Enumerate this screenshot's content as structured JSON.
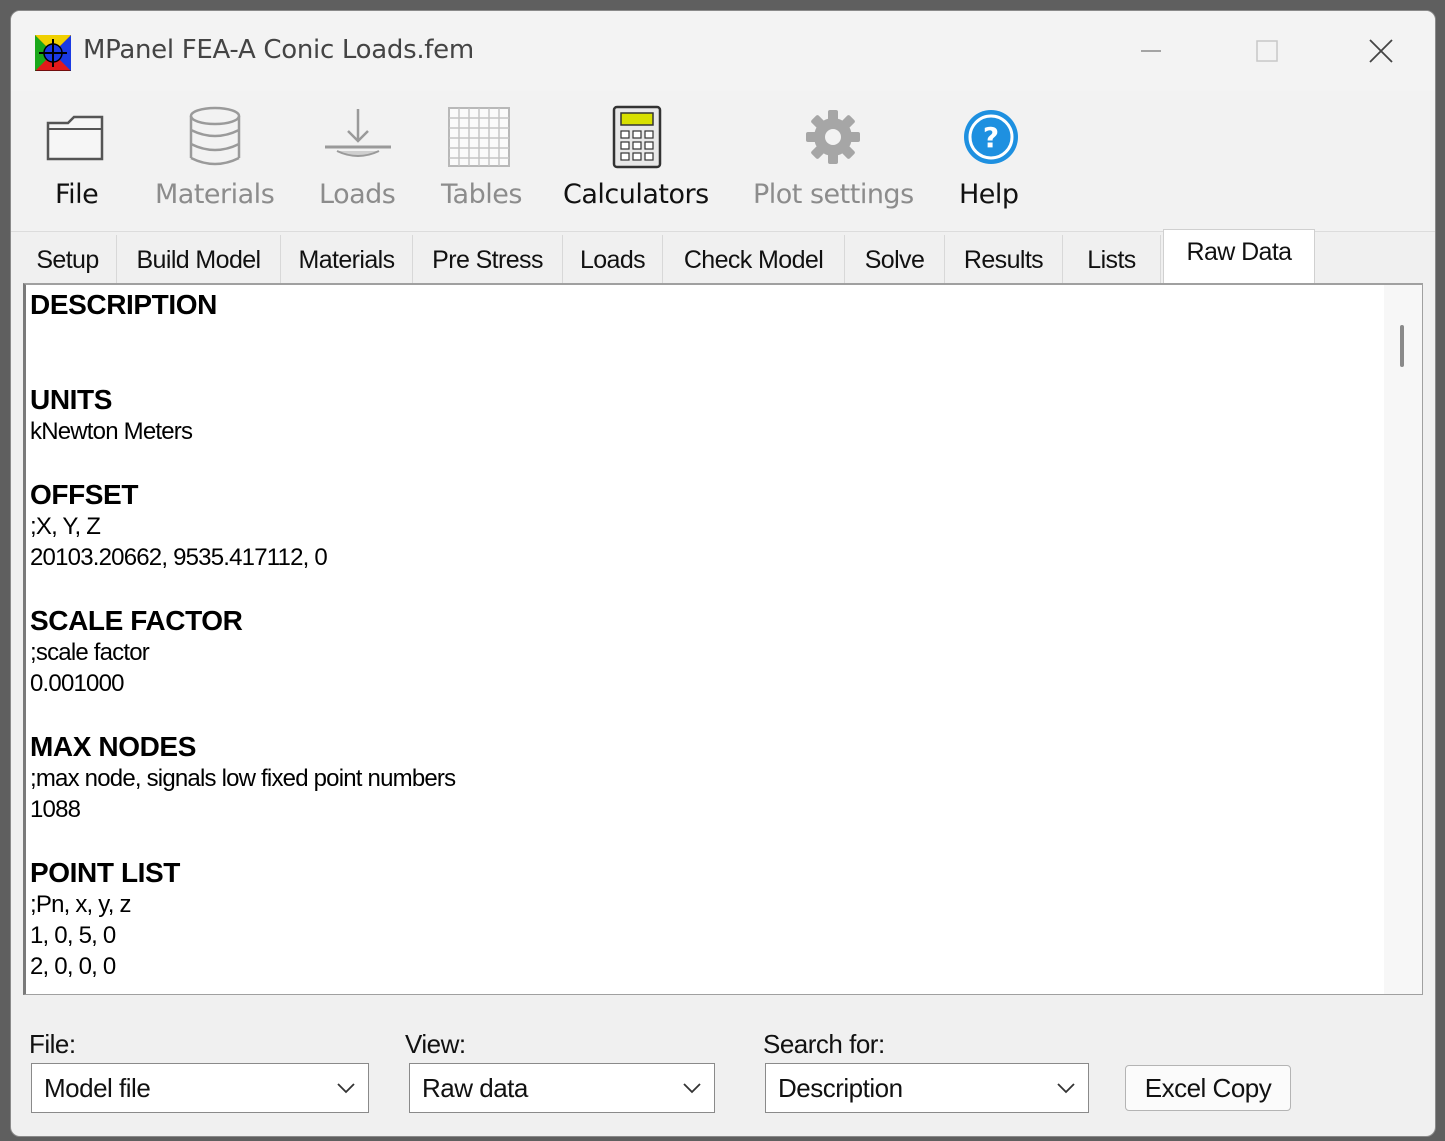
{
  "window": {
    "title": "MPanel FEA-A  Conic Loads.fem",
    "icon": "mpanel-app-icon"
  },
  "toolbar": {
    "items": [
      {
        "label": "File",
        "icon": "folder-icon",
        "enabled": true
      },
      {
        "label": "Materials",
        "icon": "database-icon",
        "enabled": false
      },
      {
        "label": "Loads",
        "icon": "load-arrow-icon",
        "enabled": false
      },
      {
        "label": "Tables",
        "icon": "table-grid-icon",
        "enabled": false
      },
      {
        "label": "Calculators",
        "icon": "calculator-icon",
        "enabled": true
      },
      {
        "label": "Plot settings",
        "icon": "gear-icon",
        "enabled": false
      },
      {
        "label": "Help",
        "icon": "help-icon",
        "enabled": true
      }
    ]
  },
  "tabs": [
    {
      "label": "Setup"
    },
    {
      "label": "Build Model"
    },
    {
      "label": "Materials"
    },
    {
      "label": "Pre Stress"
    },
    {
      "label": "Loads"
    },
    {
      "label": "Check Model"
    },
    {
      "label": "Solve"
    },
    {
      "label": "Results"
    },
    {
      "label": "Lists"
    },
    {
      "label": "Raw Data",
      "active": true
    }
  ],
  "raw_data": {
    "sections": [
      {
        "title": "DESCRIPTION",
        "lines": [
          ""
        ]
      },
      {
        "title": "UNITS",
        "lines": [
          "kNewton Meters"
        ]
      },
      {
        "title": "OFFSET",
        "lines": [
          ";X, Y, Z",
          "20103.20662, 9535.417112, 0"
        ]
      },
      {
        "title": "SCALE FACTOR",
        "lines": [
          ";scale factor",
          "0.001000"
        ]
      },
      {
        "title": "MAX NODES",
        "lines": [
          ";max node, signals low fixed point numbers",
          "1088"
        ]
      },
      {
        "title": "POINT LIST",
        "lines": [
          ";Pn, x, y, z",
          "1, 0, 5, 0",
          "2, 0, 0, 0"
        ]
      }
    ]
  },
  "footer": {
    "file_label": "File:",
    "file_value": "Model file",
    "view_label": "View:",
    "view_value": "Raw data",
    "search_label": "Search for:",
    "search_value": "Description",
    "excel_button": "Excel Copy"
  },
  "colors": {
    "help_blue": "#1e90e0",
    "calculator_screen": "#d8e000",
    "disabled_text": "#8c8c8c"
  }
}
